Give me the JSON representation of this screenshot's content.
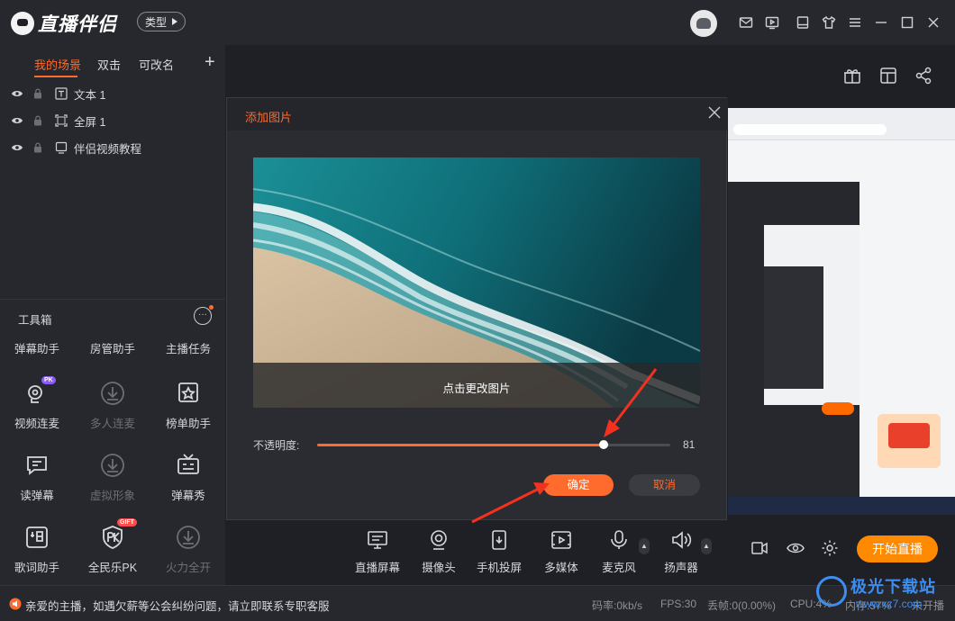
{
  "app": {
    "name": "直播伴侣",
    "type_button": "类型"
  },
  "scene_tabs": [
    "我的场景",
    "双击",
    "可改名"
  ],
  "add_scene": "+",
  "layers": [
    {
      "name": "文本 1"
    },
    {
      "name": "全屏 1"
    },
    {
      "name": "伴侣视频教程"
    }
  ],
  "toolbox": {
    "title": "工具箱",
    "more": "···",
    "text_tools": [
      "弹幕助手",
      "房管助手",
      "主播任务"
    ],
    "tools": [
      {
        "label": "视频连麦",
        "icon": "video-link-icon",
        "badge": "PK",
        "enabled": true
      },
      {
        "label": "多人连麦",
        "icon": "download-icon",
        "enabled": false
      },
      {
        "label": "榜单助手",
        "icon": "ranking-icon",
        "enabled": true
      },
      {
        "label": "读弹幕",
        "icon": "read-comment-icon",
        "enabled": true
      },
      {
        "label": "虚拟形象",
        "icon": "download-icon",
        "enabled": false
      },
      {
        "label": "弹幕秀",
        "icon": "tv-icon",
        "enabled": true
      },
      {
        "label": "歌词助手",
        "icon": "lyrics-icon",
        "enabled": true
      },
      {
        "label": "全民乐PK",
        "icon": "pk-shield-icon",
        "badge": "GIFT",
        "enabled": true
      },
      {
        "label": "火力全开",
        "icon": "download-icon",
        "enabled": false
      }
    ]
  },
  "dialog": {
    "title": "添加图片",
    "change_image": "点击更改图片",
    "opacity_label": "不透明度:",
    "opacity_value": "81",
    "opacity": 81,
    "confirm": "确定",
    "cancel": "取消"
  },
  "sources": [
    {
      "label": "直播屏幕",
      "icon": "screen-icon"
    },
    {
      "label": "摄像头",
      "icon": "camera-icon"
    },
    {
      "label": "手机投屏",
      "icon": "phone-cast-icon"
    },
    {
      "label": "多媒体",
      "icon": "media-icon"
    },
    {
      "label": "麦克风",
      "icon": "microphone-icon"
    },
    {
      "label": "扬声器",
      "icon": "speaker-icon"
    }
  ],
  "start_live": "开始直播",
  "status": {
    "notice": "亲爱的主播，如遇欠薪等公会纠纷问题，请立即联系专职客服",
    "bitrate": "码率:0kb/s",
    "fps": "FPS:30",
    "dropped": "丢帧:0(0.00%)",
    "cpu": "CPU:4%",
    "memory": "内存:57%",
    "live_state": "未开播"
  },
  "watermark": {
    "text": "极光下载站",
    "url": "www.xz7.com"
  },
  "colors": {
    "accent": "#ff6a2d",
    "start_button": "#ff8a00",
    "background": "#1e2025",
    "panel": "#26282d"
  }
}
